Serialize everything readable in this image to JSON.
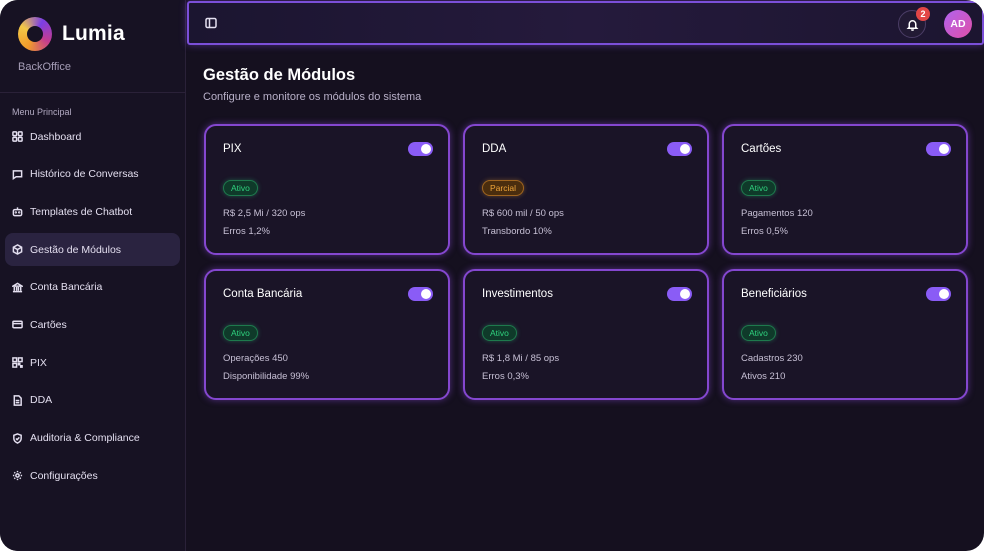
{
  "brand": {
    "name": "Lumia",
    "subtitle": "BackOffice"
  },
  "sidebar": {
    "menu_title": "Menu Principal",
    "items": [
      {
        "label": "Dashboard",
        "icon": "grid-icon",
        "active": false
      },
      {
        "label": "Histórico de Conversas",
        "icon": "message-icon",
        "active": false
      },
      {
        "label": "Templates de Chatbot",
        "icon": "bot-icon",
        "active": false
      },
      {
        "label": "Gestão de Módulos",
        "icon": "package-icon",
        "active": true
      },
      {
        "label": "Conta Bancária",
        "icon": "bank-icon",
        "active": false
      },
      {
        "label": "Cartões",
        "icon": "card-icon",
        "active": false
      },
      {
        "label": "PIX",
        "icon": "qr-icon",
        "active": false
      },
      {
        "label": "DDA",
        "icon": "file-icon",
        "active": false
      },
      {
        "label": "Auditoria & Compliance",
        "icon": "shield-icon",
        "active": false
      },
      {
        "label": "Configurações",
        "icon": "gear-icon",
        "active": false
      }
    ]
  },
  "header": {
    "notification_count": "2",
    "avatar_initials": "AD"
  },
  "main": {
    "title": "Gestão de Módulos",
    "subtitle": "Configure e monitore os módulos do sistema",
    "modules": [
      {
        "name": "PIX",
        "status": "Ativo",
        "status_type": "ativo",
        "line1": "R$ 2,5 Mi / 320 ops",
        "line2": "Erros 1,2%",
        "enabled": true
      },
      {
        "name": "DDA",
        "status": "Parcial",
        "status_type": "parcial",
        "line1": "R$ 600 mil / 50 ops",
        "line2": "Transbordo 10%",
        "enabled": true
      },
      {
        "name": "Cartões",
        "status": "Ativo",
        "status_type": "ativo",
        "line1": "Pagamentos 120",
        "line2": "Erros 0,5%",
        "enabled": true
      },
      {
        "name": "Conta Bancária",
        "status": "Ativo",
        "status_type": "ativo",
        "line1": "Operações 450",
        "line2": "Disponibilidade 99%",
        "enabled": true
      },
      {
        "name": "Investimentos",
        "status": "Ativo",
        "status_type": "ativo",
        "line1": "R$ 1,8 Mi / 85 ops",
        "line2": "Erros 0,3%",
        "enabled": true
      },
      {
        "name": "Beneficiários",
        "status": "Ativo",
        "status_type": "ativo",
        "line1": "Cadastros 230",
        "line2": "Ativos 210",
        "enabled": true
      }
    ]
  },
  "colors": {
    "accent": "#8a5cf6",
    "card_border": "#8447cf",
    "status_active": "#2fd17e",
    "status_partial": "#f0a63a",
    "background": "#15101f"
  }
}
